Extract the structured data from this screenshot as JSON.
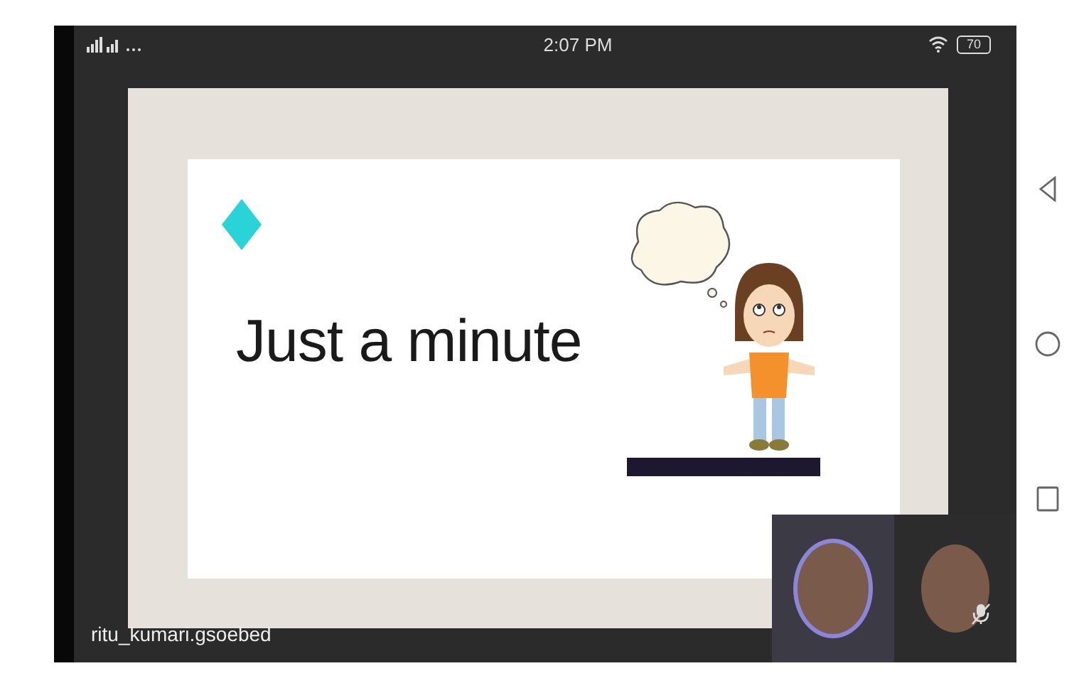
{
  "status_bar": {
    "time": "2:07 PM",
    "battery": "70"
  },
  "slide": {
    "title": "Just a minute"
  },
  "participant_name": "ritu_kumari.gsoebed",
  "participants": [
    {
      "muted": false,
      "selected": true
    },
    {
      "muted": true,
      "selected": false
    }
  ]
}
